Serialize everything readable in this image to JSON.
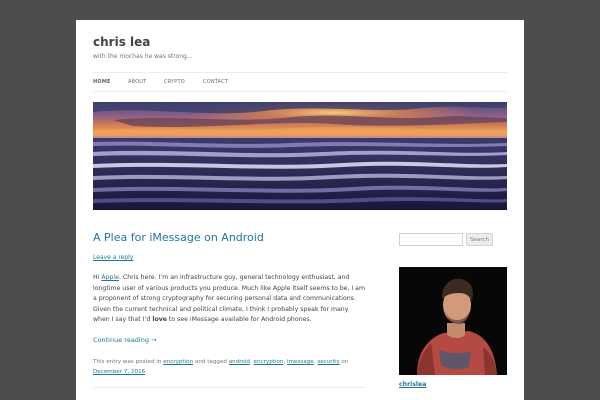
{
  "site": {
    "title": "chris lea",
    "tagline": "with the mochas he was strong..."
  },
  "nav": {
    "items": [
      {
        "label": "HOME",
        "active": true
      },
      {
        "label": "ABOUT",
        "active": false
      },
      {
        "label": "CRYPTO",
        "active": false
      },
      {
        "label": "CONTACT",
        "active": false
      }
    ]
  },
  "post": {
    "title": "A Plea for iMessage on Android",
    "leave_reply": "Leave a reply",
    "body": {
      "p1": "Hi ",
      "link_apple": "Apple",
      "p2": ". Chris here. I’m an infrastructure guy, general technology enthusiast, and longtime user of various products you produce. Much like Apple itself seems to be, I am a proponent of strong cryptography for securing personal data and communications. Given the current technical and political climate, I think I probably speak for many when I say that I’d ",
      "bold_love": "love",
      "p3": " to see iMessage available for Android phones."
    },
    "continue_reading": "Continue reading →",
    "meta": {
      "prefix": "This entry was posted in ",
      "category": "encryption",
      "tagged": " and tagged ",
      "tags": [
        "android",
        "encryption",
        "imessage",
        "security"
      ],
      "on": " on ",
      "date": "December 7, 2016",
      "end": "."
    }
  },
  "sidebar": {
    "search_placeholder": "",
    "search_button": "Search",
    "author_name": "chrislea"
  },
  "colors": {
    "background": "#4d4d4d",
    "link": "#21759b",
    "text": "#444444"
  }
}
